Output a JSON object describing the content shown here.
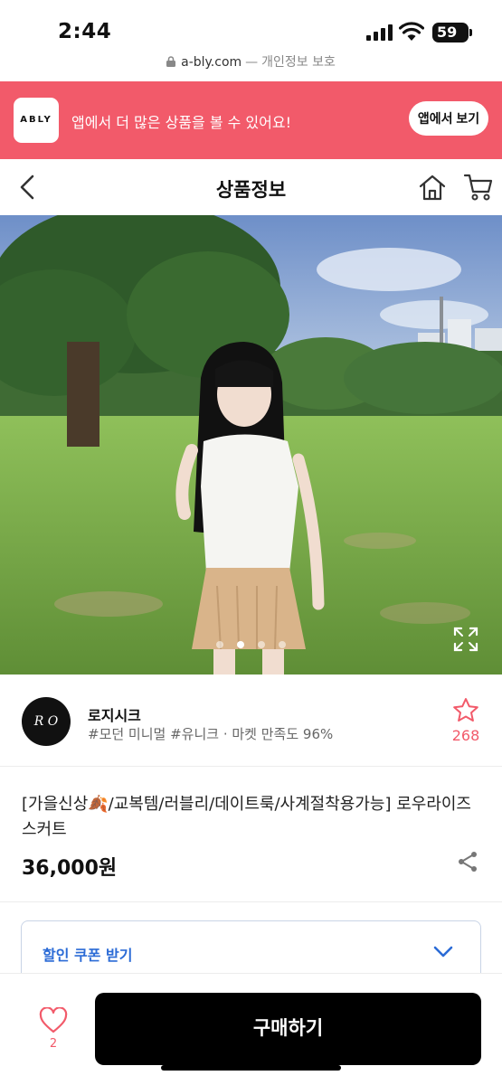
{
  "status_bar": {
    "time": "2:44",
    "battery": "59"
  },
  "url_bar": {
    "domain": "a-bly.com",
    "separator": "—",
    "note": "개인정보 보호"
  },
  "app_banner": {
    "logo_text": "ABLY",
    "message": "앱에서 더 많은 상품을 볼 수 있어요!",
    "open_button": "앱에서 보기"
  },
  "header": {
    "title": "상품정보"
  },
  "gallery": {
    "total_images": 4,
    "active_index": 1
  },
  "store": {
    "avatar_text": "R O",
    "name": "로지시크",
    "tags": "#모던 미니멀 #유니크 · 마켓 만족도 96%",
    "likes": "268"
  },
  "product": {
    "name": "[가을신상🍂/교복템/러블리/데이트룩/사계절착용가능] 로우라이즈 스커트",
    "price": "36,000원"
  },
  "coupon": {
    "label": "할인 쿠폰 받기"
  },
  "bottom_bar": {
    "heart_count": "2",
    "buy_button": "구매하기"
  },
  "colors": {
    "brand": "#f25a6a",
    "coupon_accent": "#2b6bd6",
    "buy_button_bg": "#000000"
  }
}
